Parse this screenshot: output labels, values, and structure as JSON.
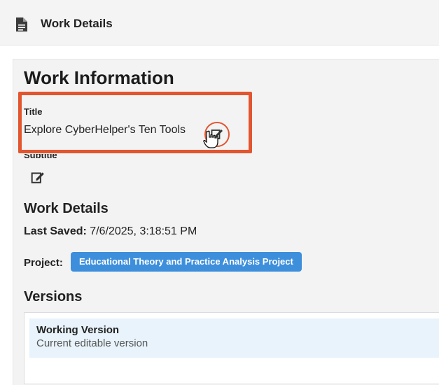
{
  "header": {
    "title": "Work Details",
    "icon": "document-icon"
  },
  "work_info": {
    "heading": "Work Information",
    "title_label": "Title",
    "title_value": "Explore CyberHelper's Ten Tools",
    "subtitle_label": "Subtitle",
    "highlight_color": "#e2552f"
  },
  "details": {
    "heading": "Work Details",
    "last_saved_label": "Last Saved:",
    "last_saved_value": "7/6/2025, 3:18:51 PM",
    "project_label": "Project:",
    "project_name": "Educational Theory and Practice Analysis Project",
    "project_color": "#3d8fdc"
  },
  "versions": {
    "heading": "Versions",
    "items": [
      {
        "name": "Working Version",
        "description": "Current editable version"
      }
    ]
  }
}
